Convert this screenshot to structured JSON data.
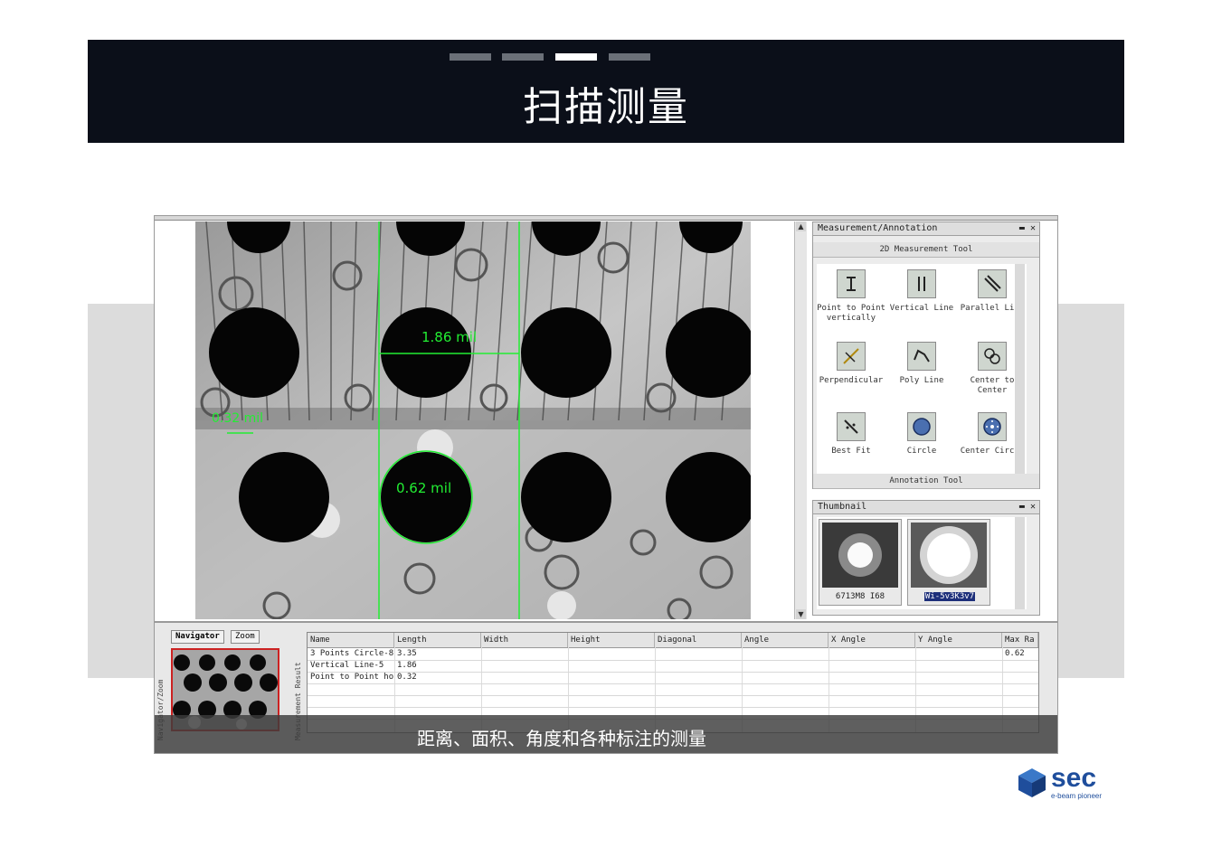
{
  "header": {
    "title": "扫描测量",
    "page_indicator": {
      "total": 4,
      "active": 3
    }
  },
  "xray": {
    "measure_labels": [
      "1.86 mil",
      "0.32 mil",
      "0.62 mil"
    ],
    "overlay_color": "#22ee33"
  },
  "measurement_panel": {
    "title": "Measurement/Annotation",
    "subhead_top": "2D Measurement Tool",
    "subhead_bottom": "Annotation Tool",
    "tools": [
      {
        "label": "Point to Point vertically",
        "icon": "point-to-point-icon"
      },
      {
        "label": "Vertical Line",
        "icon": "vertical-line-icon"
      },
      {
        "label": "Parallel Line",
        "icon": "parallel-line-icon"
      },
      {
        "label": "Perpendicular",
        "icon": "perpendicular-icon"
      },
      {
        "label": "Poly Line",
        "icon": "polyline-icon"
      },
      {
        "label": "Center to Center",
        "icon": "center-to-center-icon"
      },
      {
        "label": "Best Fit",
        "icon": "best-fit-icon"
      },
      {
        "label": "Circle",
        "icon": "circle-icon"
      },
      {
        "label": "Center Circle",
        "icon": "center-circle-icon"
      }
    ]
  },
  "thumbnail_panel": {
    "title": "Thumbnail",
    "items": [
      {
        "caption": "6713M8 I68",
        "selected": false
      },
      {
        "caption": "Wi-5v3K3v7",
        "selected": true
      }
    ]
  },
  "navigator": {
    "tabs": [
      "Navigator",
      "Zoom"
    ],
    "side_label": "Navigator/Zoom",
    "grid_side_label": "Measurement Result"
  },
  "results": {
    "columns": [
      "Name",
      "Length",
      "Width",
      "Height",
      "Diagonal",
      "Angle",
      "X Angle",
      "Y Angle",
      "Max Ra"
    ],
    "rows": [
      [
        "3 Points Circle-8",
        "3.35",
        "",
        "",
        "",
        "",
        "",
        "",
        "0.62"
      ],
      [
        "Vertical Line-5",
        "1.86",
        "",
        "",
        "",
        "",
        "",
        "",
        ""
      ],
      [
        "Point to Point ho...",
        "0.32",
        "",
        "",
        "",
        "",
        "",
        "",
        ""
      ]
    ]
  },
  "caption": "距离、面积、角度和各种标注的测量",
  "logo": {
    "word": "sec",
    "tagline": "e-beam pioneer",
    "color": "#1f4e9c"
  }
}
